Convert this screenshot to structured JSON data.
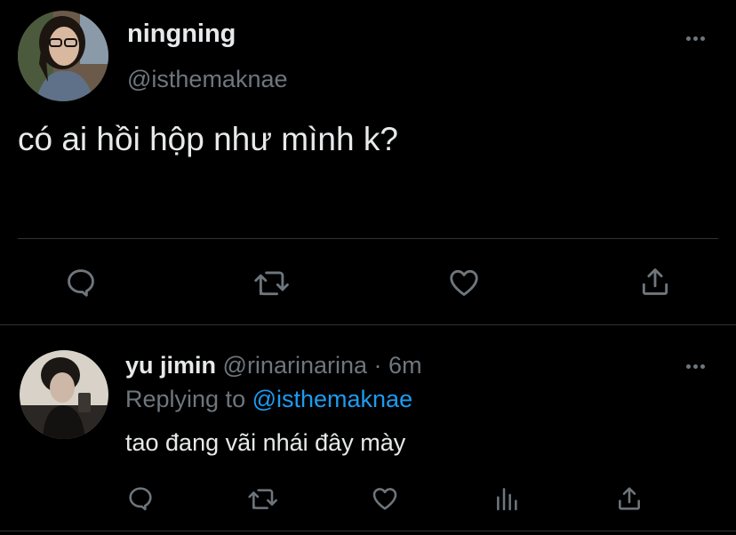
{
  "main_tweet": {
    "display_name": "ningning",
    "handle": "@isthemaknae",
    "text": "có ai hồi hộp như mình k?",
    "actions": [
      "reply-icon",
      "retweet-icon",
      "like-icon",
      "share-icon"
    ]
  },
  "reply_tweet": {
    "display_name": "yu jimin",
    "handle": "@rinarinarina",
    "separator": "·",
    "time": "6m",
    "replying_prefix": "Replying to ",
    "replying_to": "@isthemaknae",
    "text": "tao đang vãi nhái đây mày",
    "actions": [
      "reply-icon",
      "retweet-icon",
      "like-icon",
      "analytics-icon",
      "share-icon"
    ]
  },
  "colors": {
    "background": "#000000",
    "primary_text": "#e7e9ea",
    "secondary_text": "#6e767d",
    "accent": "#1d9bf0",
    "divider": "#2f3336"
  }
}
